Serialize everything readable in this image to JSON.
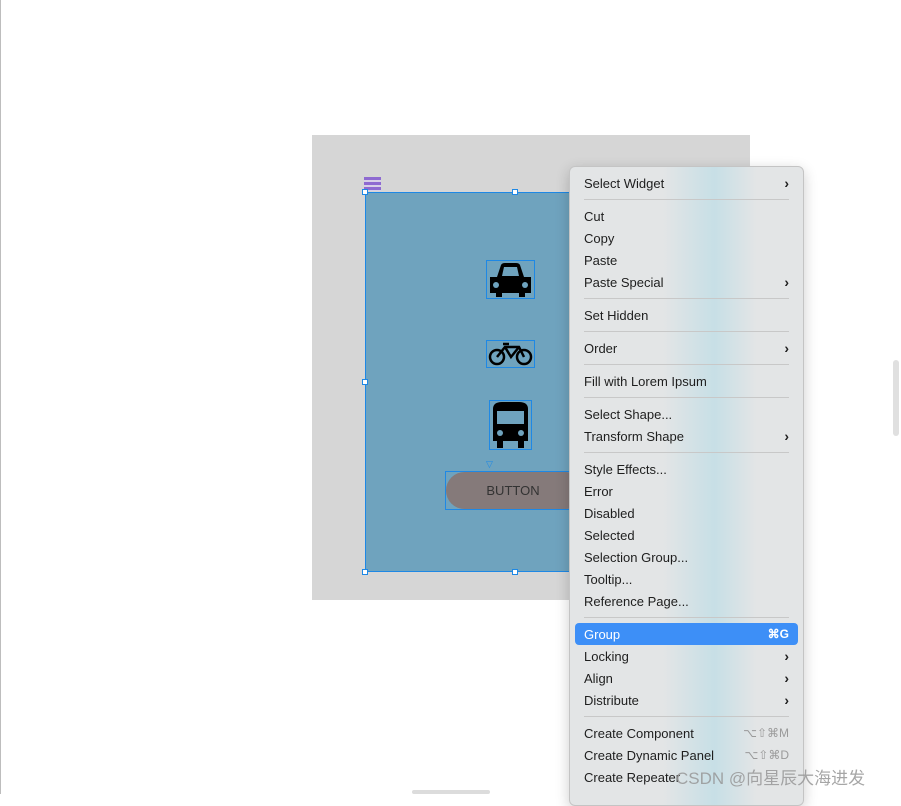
{
  "canvas": {
    "button_label": "BUTTON",
    "icons": [
      "car-icon",
      "bicycle-icon",
      "bus-icon"
    ]
  },
  "menu": {
    "items": [
      {
        "label": "Select Widget",
        "submenu": true
      },
      {
        "sep": true
      },
      {
        "label": "Cut"
      },
      {
        "label": "Copy"
      },
      {
        "label": "Paste"
      },
      {
        "label": "Paste Special",
        "submenu": true
      },
      {
        "sep": true
      },
      {
        "label": "Set Hidden"
      },
      {
        "sep": true
      },
      {
        "label": "Order",
        "submenu": true
      },
      {
        "sep": true
      },
      {
        "label": "Fill with Lorem Ipsum"
      },
      {
        "sep": true
      },
      {
        "label": "Select Shape..."
      },
      {
        "label": "Transform Shape",
        "submenu": true
      },
      {
        "sep": true
      },
      {
        "label": "Style Effects..."
      },
      {
        "label": "Error"
      },
      {
        "label": "Disabled"
      },
      {
        "label": "Selected"
      },
      {
        "label": "Selection Group..."
      },
      {
        "label": "Tooltip..."
      },
      {
        "label": "Reference Page..."
      },
      {
        "sep": true
      },
      {
        "label": "Group",
        "shortcut": "⌘G",
        "highlighted": true
      },
      {
        "label": "Locking",
        "submenu": true
      },
      {
        "label": "Align",
        "submenu": true
      },
      {
        "label": "Distribute",
        "submenu": true
      },
      {
        "sep": true
      },
      {
        "label": "Create Component",
        "shortcut": "⌥⇧⌘M"
      },
      {
        "label": "Create Dynamic Panel",
        "shortcut": "⌥⇧⌘D"
      },
      {
        "label": "Create Repeater"
      }
    ]
  },
  "watermark": "CSDN @向星辰大海进发",
  "colors": {
    "highlight": "#3d8ff7",
    "panel": "#6fa3be",
    "selection": "#1e88e5"
  }
}
